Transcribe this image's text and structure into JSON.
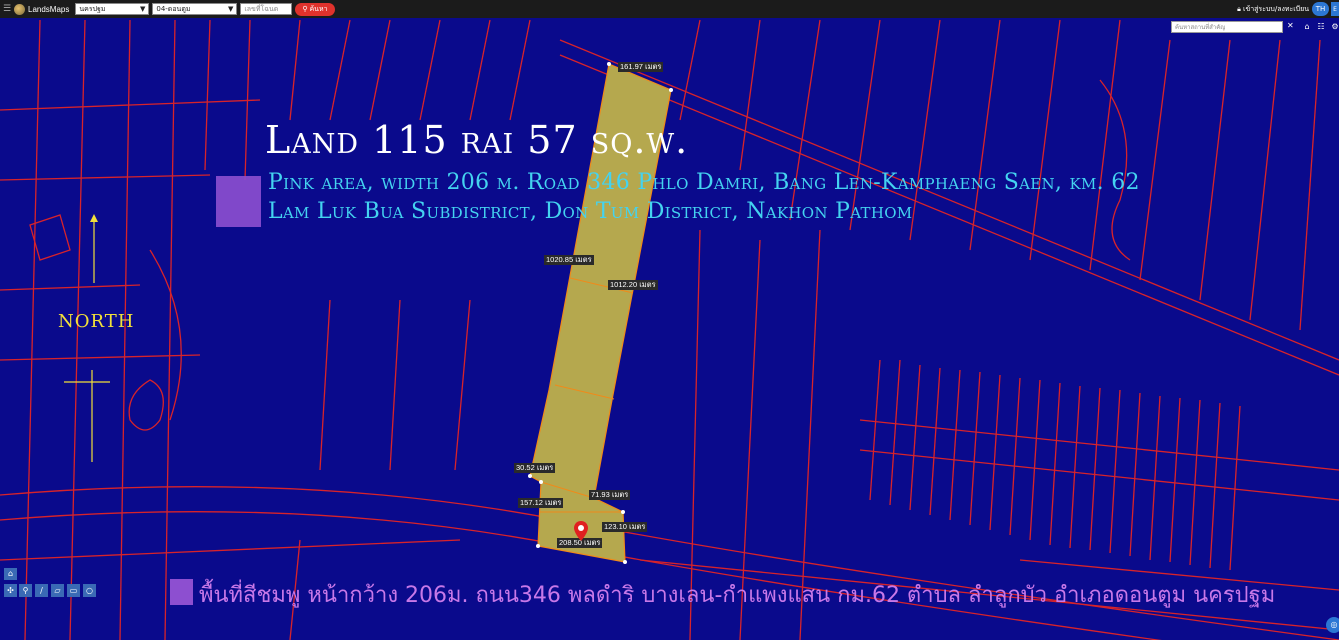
{
  "topbar": {
    "brand": "LandsMaps",
    "province": "นครปฐม",
    "district": "04-ดอนตูม",
    "parcel_placeholder": "เลขที่โฉนด",
    "search_label": "ค้นหา",
    "login_label": "เข้าสู่ระบบ/ลงทะเบียน",
    "lang": "TH",
    "lang2": "E"
  },
  "place_search": {
    "placeholder": "ค้นหาสถานที่สำคัญ"
  },
  "overlay": {
    "title": "Land 115 rai 57 sq.w.",
    "subtitle_line1": "Pink area, width 206 m. Road 346 Phlo Damri, Bang Len-Kamphaeng Saen, km. 62",
    "subtitle_line2": "Lam Luk Bua Subdistrict, Don Tum District, Nakhon Pathom",
    "north_label": "NORTH",
    "thai_caption": "พื้นที่สีชมพู หน้ากว้าง 206ม. ถนน346 พลดำริ บางเลน-กำแพงแสน กม.62 ตำบล ลำลูกบัว อำเภอดอนตูม นครปฐม"
  },
  "measurements": [
    "161.97 เมตร",
    "1020.85 เมตร",
    "1012.20 เมตร",
    "30.52 เมตร",
    "71.93 เมตร",
    "157.12 เมตร",
    "123.10 เมตร",
    "208.50 เมตร"
  ],
  "colors": {
    "background": "#0a0a8c",
    "parcel_lines": "#d8232a",
    "plot_fill": "#b5a84e",
    "plot_outline": "#f08a1a",
    "title": "#ffffff",
    "subtitle": "#44d3f0",
    "north": "#f2e03a",
    "pink_area": "#8d4fd0",
    "thai_caption": "#c878e8"
  },
  "icons": [
    "menu-icon",
    "search-icon",
    "lock-icon",
    "close-icon",
    "home-icon",
    "layers-icon",
    "map-pin-icon",
    "locate-icon"
  ]
}
